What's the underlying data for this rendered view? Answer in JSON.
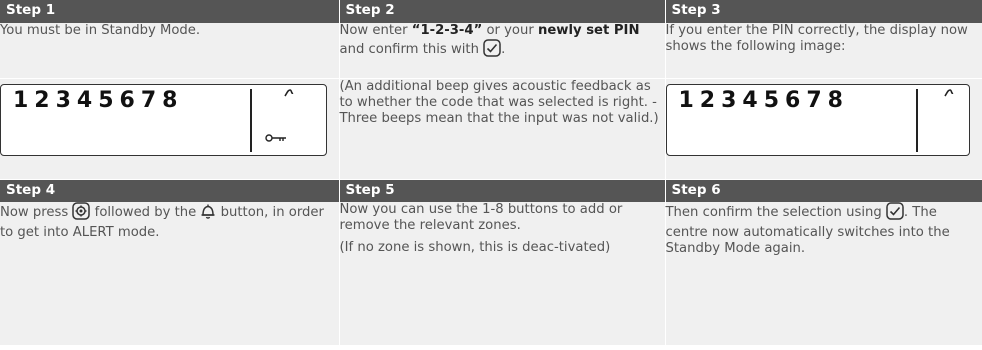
{
  "headers": [
    "Step  1",
    "Step  2",
    "Step 3",
    "Step  4",
    "Step  5",
    "Step 6"
  ],
  "step1": {
    "text": "You must be in Standby Mode.",
    "display_digits": "12345678"
  },
  "step2": {
    "pre": "Now enter ",
    "pin_default": "“1-2-3-4”",
    "mid": " or your ",
    "pin_new": "newly set PIN",
    "post": " and confirm this with",
    "end": ".",
    "note": "(An additional beep gives acoustic feedback as to whether the code that was selected is right. - Three beeps mean that the input was not valid.)"
  },
  "step3": {
    "text": "If you enter the PIN correctly, the display now shows the following image:",
    "display_digits": "12345678"
  },
  "step4": {
    "pre": "Now press",
    "mid": " followed by the",
    "post": " button, in order to get into ALERT mode."
  },
  "step5": {
    "text": "Now you can use the 1-8 buttons to add or remove the relevant zones.",
    "note": "(If no zone is shown, this is deac-tivated)"
  },
  "step6": {
    "pre": "Then confirm the selection using",
    "post": ". The centre now automatically switches into the Standby Mode again."
  },
  "icons": [
    "check-icon",
    "settings-icon",
    "bell-icon",
    "signal-icon",
    "key-icon"
  ]
}
